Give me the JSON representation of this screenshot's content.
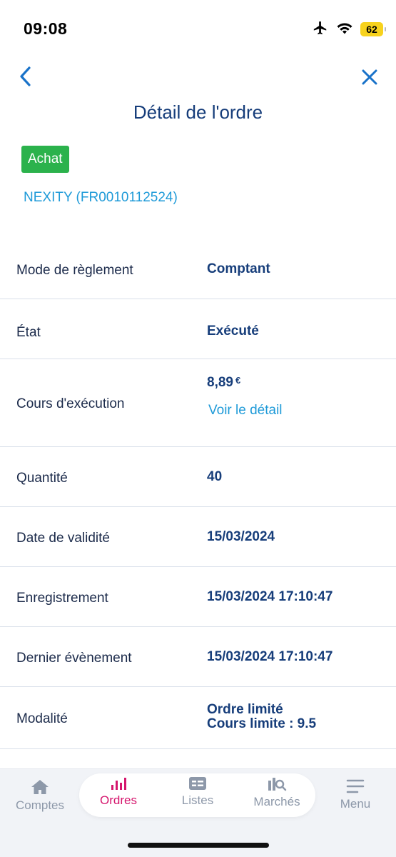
{
  "status": {
    "time": "09:08",
    "battery": "62"
  },
  "header": {
    "title": "Détail de l'ordre"
  },
  "order": {
    "badge": "Achat",
    "instrument": "NEXITY (FR0010112524)"
  },
  "details": {
    "payment_mode": {
      "label": "Mode de règlement",
      "value": "Comptant"
    },
    "state": {
      "label": "État",
      "value": "Exécuté"
    },
    "execution_price": {
      "label": "Cours d'exécution",
      "value": "8,89",
      "currency": "€",
      "link": "Voir le détail"
    },
    "quantity": {
      "label": "Quantité",
      "value": "40"
    },
    "validity_date": {
      "label": "Date de validité",
      "value": "15/03/2024"
    },
    "registration": {
      "label": "Enregistrement",
      "value": "15/03/2024 17:10:47"
    },
    "last_event": {
      "label": "Dernier évènement",
      "value": "15/03/2024 17:10:47"
    },
    "modality": {
      "label": "Modalité",
      "line1": "Ordre limité",
      "line2": "Cours limite : 9.5"
    }
  },
  "tabs": [
    {
      "label": "Comptes",
      "icon": "home-icon"
    },
    {
      "label": "Ordres",
      "icon": "bar-chart-icon",
      "active": true
    },
    {
      "label": "Listes",
      "icon": "list-card-icon"
    },
    {
      "label": "Marchés",
      "icon": "market-search-icon"
    },
    {
      "label": "Menu",
      "icon": "hamburger-icon"
    }
  ],
  "colors": {
    "primary": "#163d7a",
    "link": "#1e9ad8",
    "buy_badge": "#2bb24c",
    "active_tab": "#d5166d",
    "inactive_tab": "#8d98a9"
  }
}
